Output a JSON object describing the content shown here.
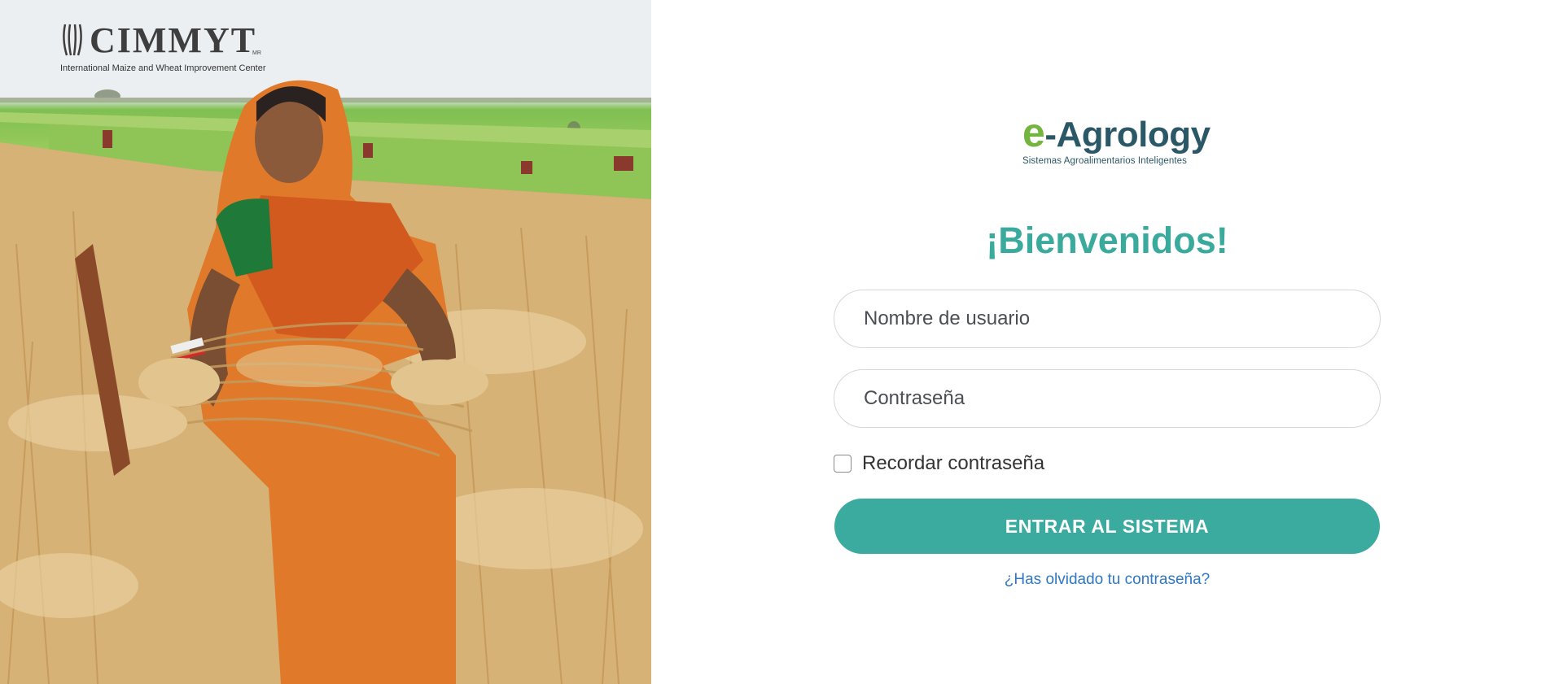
{
  "photo": {
    "org_logo": {
      "name": "CIMMYT",
      "mark": "MR",
      "subtitle": "International Maize and Wheat Improvement Center"
    }
  },
  "brand": {
    "prefix": "e",
    "name": "-Agrology",
    "tagline": "Sistemas Agroalimentarios Inteligentes",
    "colors": {
      "green": "#74b53f",
      "navy": "#2b5866"
    }
  },
  "login": {
    "title": "¡Bienvenidos!",
    "username_placeholder": "Nombre de usuario",
    "password_placeholder": "Contraseña",
    "remember_label": "Recordar contraseña",
    "remember_checked": false,
    "submit_label": "ENTRAR AL SISTEMA",
    "forgot_link": "¿Has olvidado tu contraseña?",
    "colors": {
      "accent": "#3aab9e",
      "link": "#2f78c4"
    }
  }
}
